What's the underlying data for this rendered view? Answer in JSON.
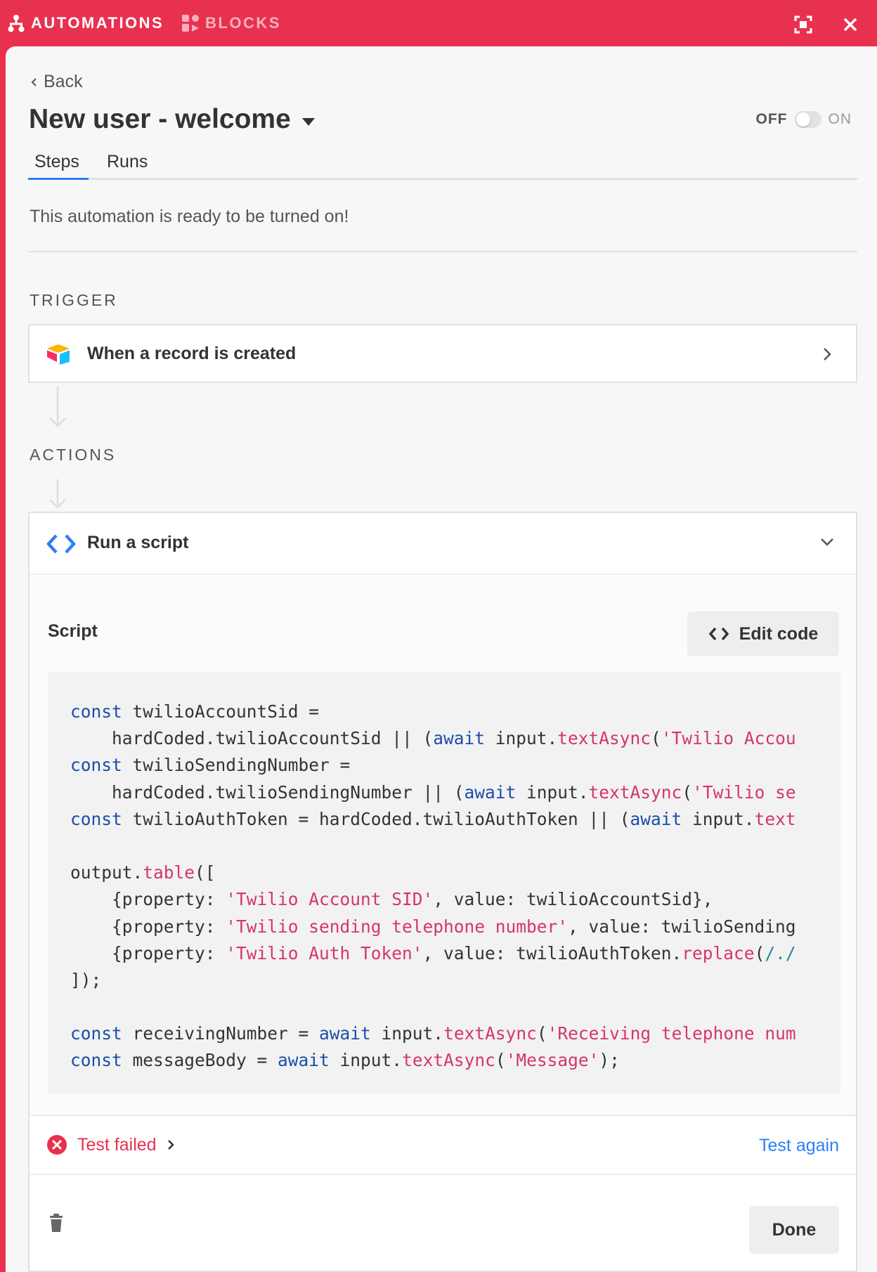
{
  "topbar": {
    "automations_label": "AUTOMATIONS",
    "blocks_label": "BLOCKS",
    "expand_icon": "expand-icon",
    "close_icon": "close-icon"
  },
  "header": {
    "back_label": "Back",
    "title": "New user - welcome",
    "toggle_off": "OFF",
    "toggle_on": "ON"
  },
  "tabs": [
    {
      "label": "Steps",
      "active": true
    },
    {
      "label": "Runs",
      "active": false
    }
  ],
  "status_message": "This automation is ready to be turned on!",
  "trigger": {
    "section_label": "TRIGGER",
    "label": "When a record is created"
  },
  "actions": {
    "section_label": "ACTIONS",
    "label": "Run a script",
    "script_label": "Script",
    "edit_code_label": "Edit code",
    "code_lines": [
      [
        [
          "kw",
          "const"
        ],
        [
          "",
          "twilioAccountSid ="
        ]
      ],
      [
        [
          "",
          "    hardCoded.twilioAccountSid || ("
        ],
        [
          "kw",
          "await"
        ],
        [
          "",
          " input."
        ],
        [
          "fn",
          "textAsync"
        ],
        [
          "",
          "("
        ],
        [
          "str",
          "'Twilio Accou"
        ]
      ],
      [
        [
          "kw",
          "const"
        ],
        [
          "",
          "twilioSendingNumber ="
        ]
      ],
      [
        [
          "",
          "    hardCoded.twilioSendingNumber || ("
        ],
        [
          "kw",
          "await"
        ],
        [
          "",
          " input."
        ],
        [
          "fn",
          "textAsync"
        ],
        [
          "",
          "("
        ],
        [
          "str",
          "'Twilio se"
        ]
      ],
      [
        [
          "kw",
          "const"
        ],
        [
          "",
          "twilioAuthToken = hardCoded.twilioAuthToken || ("
        ],
        [
          "kw",
          "await"
        ],
        [
          "",
          " input."
        ],
        [
          "fn",
          "text"
        ]
      ],
      [],
      [
        [
          "",
          "output."
        ],
        [
          "fn",
          "table"
        ],
        [
          "",
          "(["
        ]
      ],
      [
        [
          "",
          "    {property: "
        ],
        [
          "str",
          "'Twilio Account SID'"
        ],
        [
          "",
          ", value: twilioAccountSid},"
        ]
      ],
      [
        [
          "",
          "    {property: "
        ],
        [
          "str",
          "'Twilio sending telephone number'"
        ],
        [
          "",
          ", value: twilioSending"
        ]
      ],
      [
        [
          "",
          "    {property: "
        ],
        [
          "str",
          "'Twilio Auth Token'"
        ],
        [
          "",
          ", value: twilioAuthToken."
        ],
        [
          "fn",
          "replace"
        ],
        [
          "",
          "("
        ],
        [
          "re",
          "/./"
        ]
      ],
      [
        [
          "",
          "]);"
        ]
      ],
      [],
      [
        [
          "kw",
          "const"
        ],
        [
          "",
          "receivingNumber = "
        ],
        [
          "kw",
          "await"
        ],
        [
          "",
          " input."
        ],
        [
          "fn",
          "textAsync"
        ],
        [
          "",
          "("
        ],
        [
          "str",
          "'Receiving telephone num"
        ]
      ],
      [
        [
          "kw",
          "const"
        ],
        [
          "",
          "messageBody = "
        ],
        [
          "kw",
          "await"
        ],
        [
          "",
          " input."
        ],
        [
          "fn",
          "textAsync"
        ],
        [
          "",
          "("
        ],
        [
          "str",
          "'Message'"
        ],
        [
          "",
          ");"
        ]
      ]
    ],
    "test_status": "Test failed",
    "test_again_label": "Test again",
    "done_label": "Done"
  }
}
